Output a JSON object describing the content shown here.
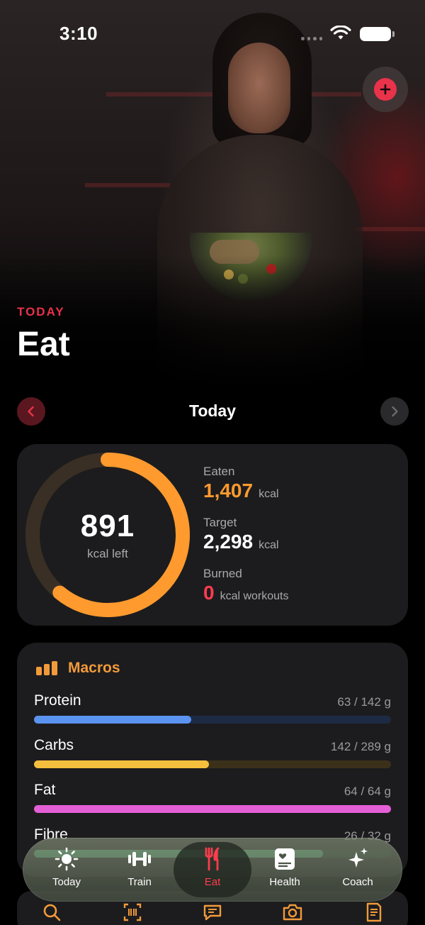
{
  "status_bar": {
    "time": "3:10"
  },
  "header": {
    "eyebrow": "TODAY",
    "title": "Eat"
  },
  "date_nav": {
    "label": "Today"
  },
  "calories": {
    "left_value": "891",
    "left_label": "kcal left",
    "progress_fraction": 0.61,
    "ring_color": "#ff9a2e",
    "eaten": {
      "label": "Eaten",
      "value": "1,407",
      "unit": "kcal",
      "color": "#ff9a2e"
    },
    "target": {
      "label": "Target",
      "value": "2,298",
      "unit": "kcal",
      "color": "#ffffff"
    },
    "burned": {
      "label": "Burned",
      "value": "0",
      "unit": "kcal workouts",
      "color": "#ff3b4e"
    }
  },
  "macros": {
    "title": "Macros",
    "items": [
      {
        "name": "Protein",
        "value_text": "63 / 142 g",
        "fraction": 0.44,
        "color": "#5b93f0",
        "track": "#1d2a44"
      },
      {
        "name": "Carbs",
        "value_text": "142 / 289 g",
        "fraction": 0.49,
        "color": "#f4bf3c",
        "track": "#3b311a"
      },
      {
        "name": "Fat",
        "value_text": "64 / 64 g",
        "fraction": 1.0,
        "color": "#e45fd6",
        "track": "#3b1a38"
      },
      {
        "name": "Fibre",
        "value_text": "26 / 32 g",
        "fraction": 0.81,
        "color": "#5fd08a",
        "track": "#1a3524"
      }
    ]
  },
  "tabs": [
    {
      "label": "Today",
      "icon": "sun-icon",
      "active": false
    },
    {
      "label": "Train",
      "icon": "dumbbell-icon",
      "active": false
    },
    {
      "label": "Eat",
      "icon": "fork-knife-icon",
      "active": true
    },
    {
      "label": "Health",
      "icon": "health-book-icon",
      "active": false
    },
    {
      "label": "Coach",
      "icon": "sparkles-icon",
      "active": false
    }
  ],
  "quick_actions": [
    "search-icon",
    "barcode-scan-icon",
    "chat-icon",
    "camera-icon",
    "notes-icon"
  ],
  "colors": {
    "accent": "#e8334a",
    "orange": "#f29a3a",
    "card_bg": "#1c1c1e"
  }
}
